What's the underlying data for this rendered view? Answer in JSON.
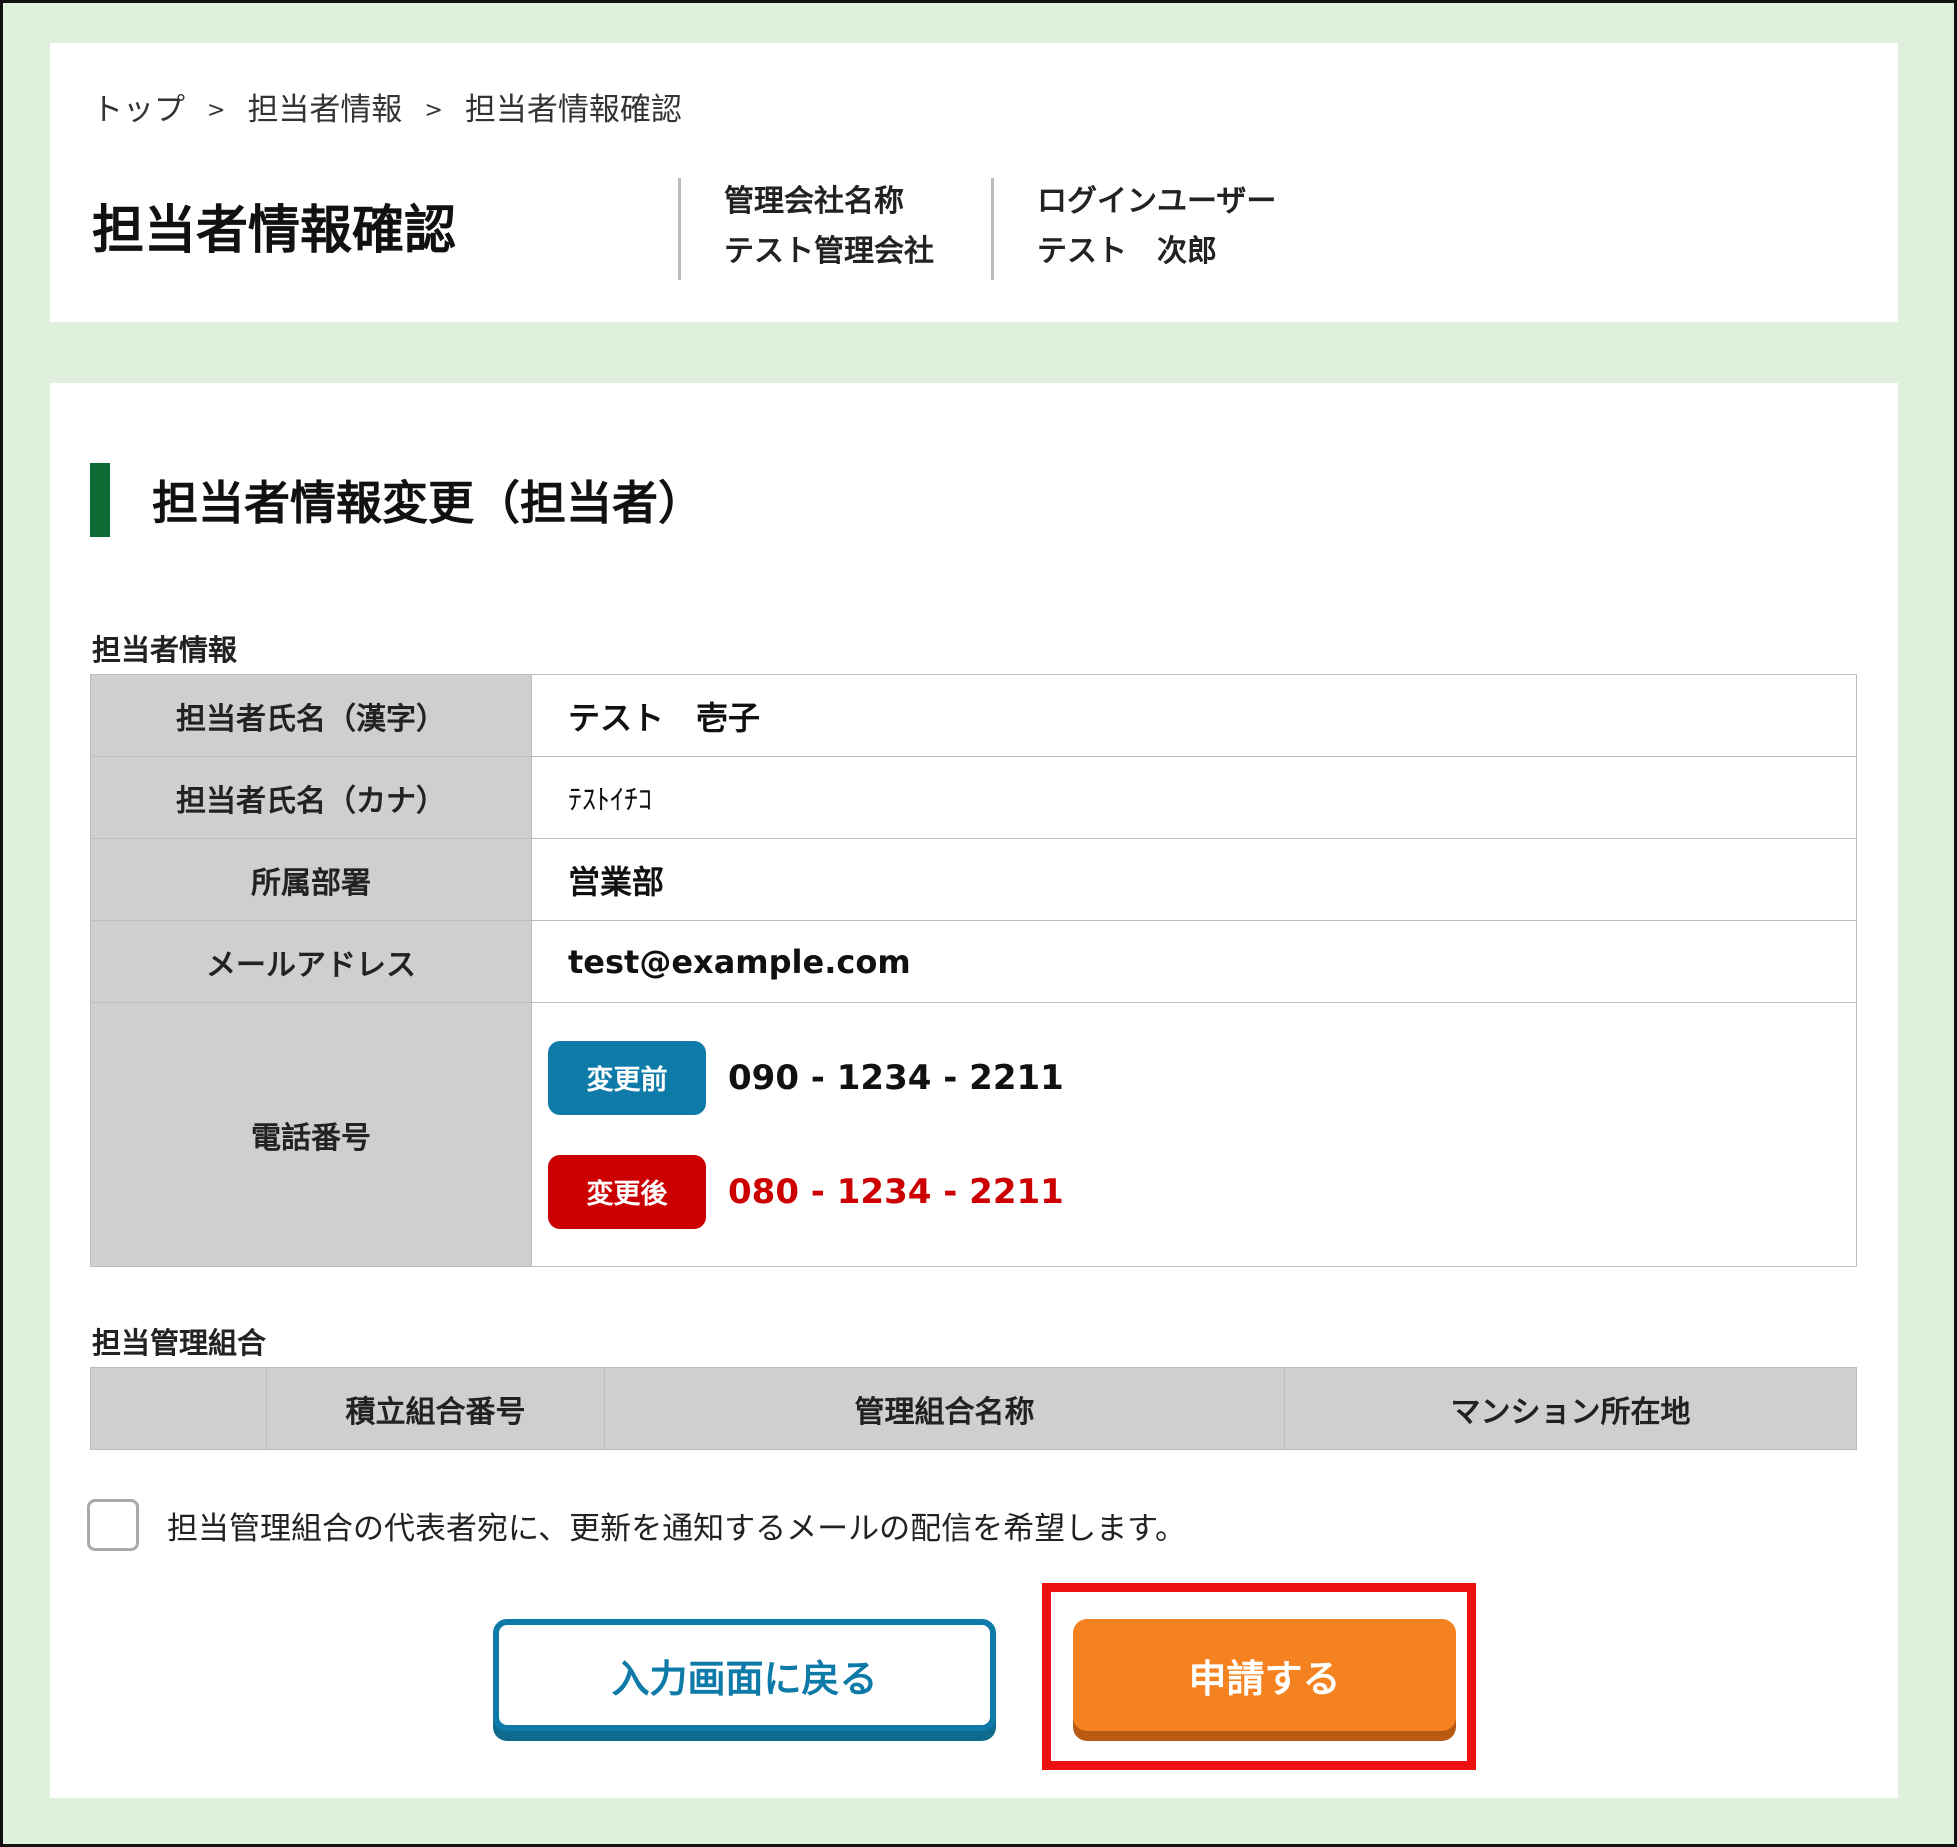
{
  "breadcrumb": {
    "items": [
      "トップ",
      "担当者情報",
      "担当者情報確認"
    ],
    "separator": ">"
  },
  "header": {
    "title": "担当者情報確認",
    "company_label": "管理会社名称",
    "company_value": "テスト管理会社",
    "user_label": "ログインユーザー",
    "user_value": "テスト　次郎"
  },
  "section": {
    "heading": "担当者情報変更（担当者）",
    "accent_color": "#0e6b34"
  },
  "person_info": {
    "label": "担当者情報",
    "rows": [
      {
        "label": "担当者氏名（漢字）",
        "value": "テスト　壱子"
      },
      {
        "label": "担当者氏名（カナ）",
        "value": "ﾃｽﾄｲﾁｺ"
      },
      {
        "label": "所属部署",
        "value": "営業部"
      },
      {
        "label": "メールアドレス",
        "value": "test@example.com"
      }
    ],
    "phone": {
      "label": "電話番号",
      "before_badge": "変更前",
      "before_value": "090 - 1234 - 2211",
      "after_badge": "変更後",
      "after_value": "080 - 1234 - 2211"
    }
  },
  "union": {
    "label": "担当管理組合",
    "columns": [
      "",
      "積立組合番号",
      "管理組合名称",
      "マンション所在地"
    ]
  },
  "notify_checkbox": {
    "label": "担当管理組合の代表者宛に、更新を通知するメールの配信を希望します。",
    "checked": false
  },
  "buttons": {
    "back": "入力画面に戻る",
    "apply": "申請する"
  },
  "colors": {
    "background": "#dff0dc",
    "before_badge": "#0e7aa8",
    "after_badge": "#cc0000",
    "apply_button": "#f58220",
    "highlight": "#ee1111"
  }
}
